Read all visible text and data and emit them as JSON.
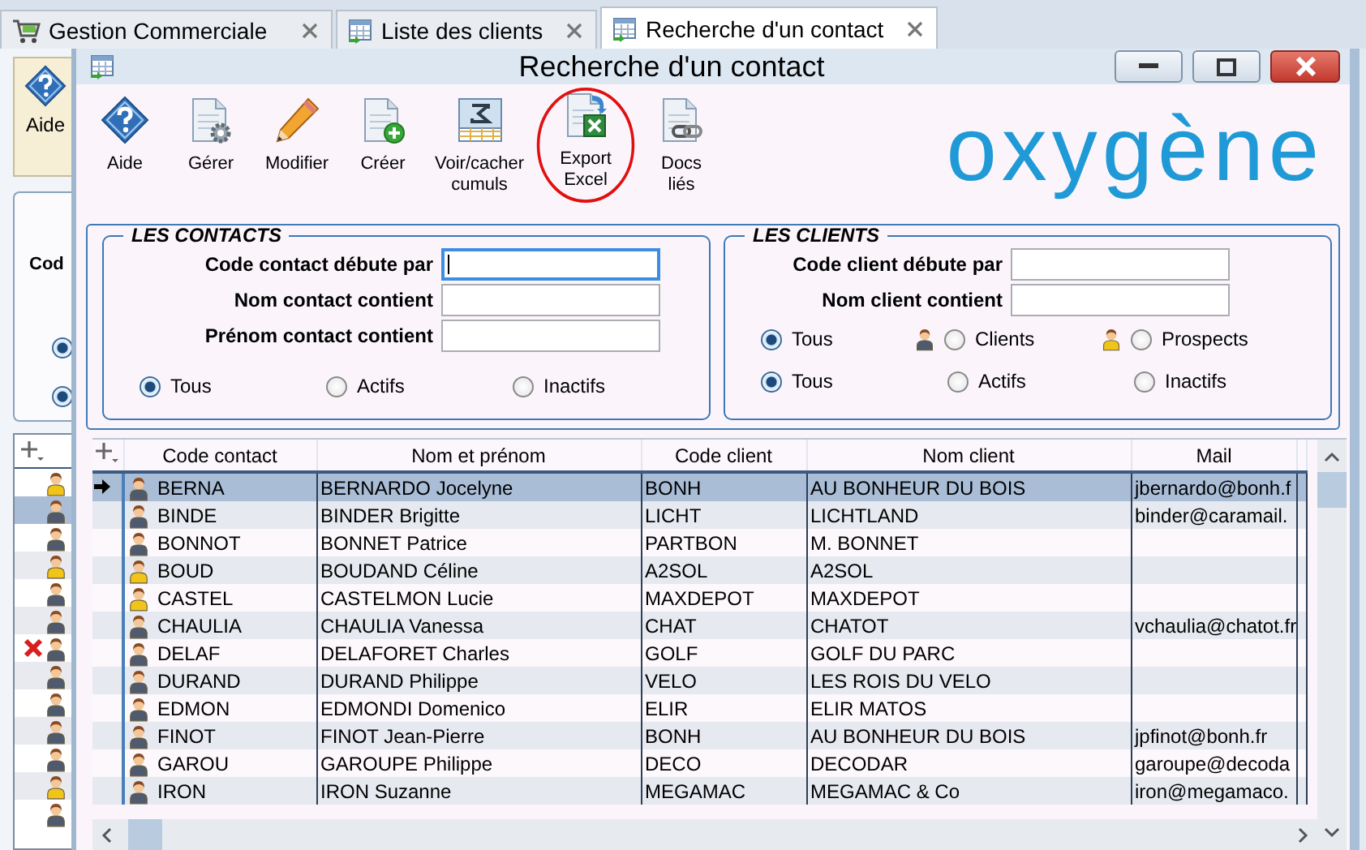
{
  "tabs": [
    {
      "label": "Gestion Commerciale",
      "kind": "cart",
      "selected": false
    },
    {
      "label": "Liste des clients",
      "kind": "table",
      "selected": false
    },
    {
      "label": "Recherche d'un contact",
      "kind": "table",
      "selected": true
    }
  ],
  "background_window": {
    "help_label": "Aide",
    "field_label": "Cod",
    "radios": [
      {
        "selected": true
      },
      {
        "selected": true
      }
    ],
    "rows": [
      {
        "kind": "prospect",
        "selected": false,
        "deleted": false
      },
      {
        "kind": "client",
        "selected": true,
        "deleted": false
      },
      {
        "kind": "client",
        "selected": false,
        "deleted": false
      },
      {
        "kind": "prospect",
        "selected": false,
        "deleted": false
      },
      {
        "kind": "client",
        "selected": false,
        "deleted": false
      },
      {
        "kind": "client",
        "selected": false,
        "deleted": false
      },
      {
        "kind": "client",
        "selected": false,
        "deleted": true
      },
      {
        "kind": "client",
        "selected": false,
        "deleted": false
      },
      {
        "kind": "client",
        "selected": false,
        "deleted": false
      },
      {
        "kind": "client",
        "selected": false,
        "deleted": false
      },
      {
        "kind": "client",
        "selected": false,
        "deleted": false
      },
      {
        "kind": "prospect",
        "selected": false,
        "deleted": false
      },
      {
        "kind": "client",
        "selected": false,
        "deleted": false
      }
    ]
  },
  "dialog": {
    "title": "Recherche d'un contact",
    "toolbar": [
      {
        "kind": "help",
        "label": "Aide",
        "highlighted": false
      },
      {
        "kind": "manage",
        "label": "Gérer",
        "highlighted": false
      },
      {
        "kind": "edit",
        "label": "Modifier",
        "highlighted": false
      },
      {
        "kind": "create",
        "label": "Créer",
        "highlighted": false
      },
      {
        "kind": "totals",
        "label": "Voir/cacher\ncumuls",
        "highlighted": false
      },
      {
        "kind": "export",
        "label": "Export\nExcel",
        "highlighted": true
      },
      {
        "kind": "link",
        "label": "Docs\nliés",
        "highlighted": false
      }
    ],
    "logo": "oxygène",
    "contacts_filter": {
      "title": "LES CONTACTS",
      "fields": [
        {
          "label": "Code contact débute par",
          "focused": true
        },
        {
          "label": "Nom contact contient",
          "focused": false
        },
        {
          "label": "Prénom contact contient",
          "focused": false
        }
      ],
      "status_radios": [
        {
          "label": "Tous",
          "selected": true
        },
        {
          "label": "Actifs",
          "selected": false
        },
        {
          "label": "Inactifs",
          "selected": false
        }
      ]
    },
    "clients_filter": {
      "title": "LES CLIENTS",
      "fields": [
        {
          "label": "Code client débute par",
          "focused": false
        },
        {
          "label": "Nom client contient",
          "focused": false
        }
      ],
      "type_radios": [
        {
          "label": "Tous",
          "kind": "all",
          "selected": true
        },
        {
          "label": "Clients",
          "kind": "client",
          "selected": false
        },
        {
          "label": "Prospects",
          "kind": "prospect",
          "selected": false
        }
      ],
      "status_radios": [
        {
          "label": "Tous",
          "selected": true
        },
        {
          "label": "Actifs",
          "selected": false
        },
        {
          "label": "Inactifs",
          "selected": false
        }
      ]
    },
    "grid": {
      "columns": [
        "Code contact",
        "Nom et prénom",
        "Code client",
        "Nom client",
        "Mail"
      ],
      "rows": [
        {
          "selected": true,
          "kind": "client",
          "code_contact": "BERNA",
          "name": "BERNARDO Jocelyne",
          "code_client": "BONH",
          "client_name": "AU BONHEUR DU BOIS",
          "mail": "jbernardo@bonh.f"
        },
        {
          "selected": false,
          "kind": "client",
          "code_contact": "BINDE",
          "name": "BINDER Brigitte",
          "code_client": "LICHT",
          "client_name": "LICHTLAND",
          "mail": "binder@caramail."
        },
        {
          "selected": false,
          "kind": "client",
          "code_contact": "BONNOT",
          "name": "BONNET Patrice",
          "code_client": "PARTBON",
          "client_name": "M. BONNET"
        },
        {
          "selected": false,
          "kind": "prospect",
          "code_contact": "BOUD",
          "name": "BOUDAND Céline",
          "code_client": "A2SOL",
          "client_name": "A2SOL"
        },
        {
          "selected": false,
          "kind": "prospect",
          "code_contact": "CASTEL",
          "name": "CASTELMON Lucie",
          "code_client": "MAXDEPOT",
          "client_name": "MAXDEPOT"
        },
        {
          "selected": false,
          "kind": "client",
          "code_contact": "CHAULIA",
          "name": "CHAULIA Vanessa",
          "code_client": "CHAT",
          "client_name": "CHATOT",
          "mail": "vchaulia@chatot.fr"
        },
        {
          "selected": false,
          "kind": "client",
          "code_contact": "DELAF",
          "name": "DELAFORET Charles",
          "code_client": "GOLF",
          "client_name": "GOLF DU PARC"
        },
        {
          "selected": false,
          "kind": "client",
          "code_contact": "DURAND",
          "name": "DURAND Philippe",
          "code_client": "VELO",
          "client_name": "LES ROIS DU VELO"
        },
        {
          "selected": false,
          "kind": "client",
          "code_contact": "EDMON",
          "name": "EDMONDI Domenico",
          "code_client": "ELIR",
          "client_name": "ELIR MATOS"
        },
        {
          "selected": false,
          "kind": "client",
          "code_contact": "FINOT",
          "name": "FINOT Jean-Pierre",
          "code_client": "BONH",
          "client_name": "AU BONHEUR DU BOIS",
          "mail": "jpfinot@bonh.fr"
        },
        {
          "selected": false,
          "kind": "client",
          "code_contact": "GAROU",
          "name": "GAROUPE Philippe",
          "code_client": "DECO",
          "client_name": "DECODAR",
          "mail": "garoupe@decoda"
        },
        {
          "selected": false,
          "kind": "client",
          "code_contact": "IRON",
          "name": "IRON Suzanne",
          "code_client": "MEGAMAC",
          "client_name": "MEGAMAC & Co",
          "mail": "iron@megamaco."
        }
      ]
    }
  }
}
